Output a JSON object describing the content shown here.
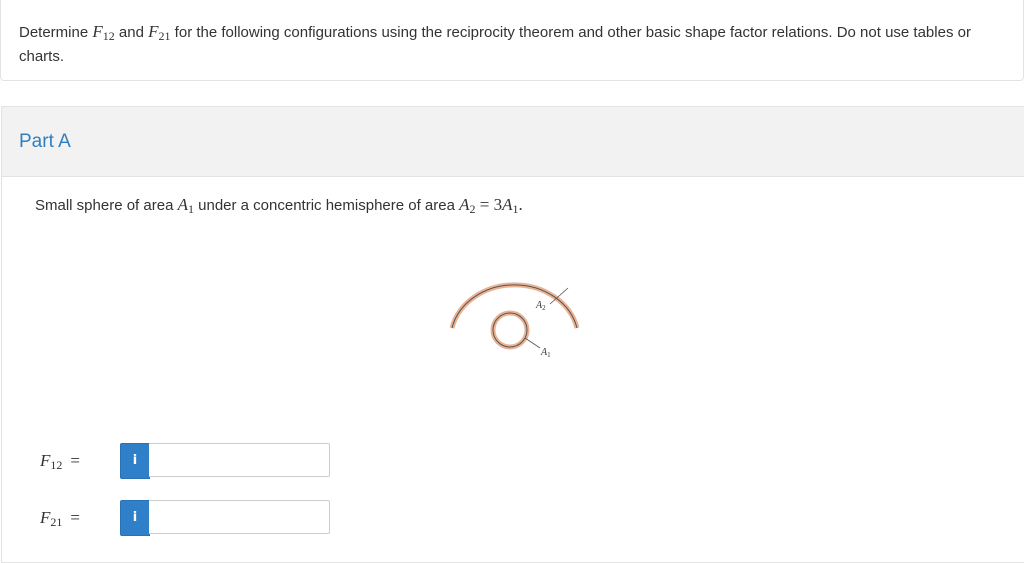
{
  "question": {
    "prefix": "Determine ",
    "f12_sym": "F",
    "f12_sub": "12",
    "and_word": " and ",
    "f21_sym": "F",
    "f21_sub": "21",
    "suffix": " for the following configurations using the reciprocity theorem and other basic shape factor relations. Do not use tables or charts."
  },
  "part": {
    "title": "Part A",
    "desc_prefix": "Small sphere of area ",
    "a1_sym": "A",
    "a1_sub": "1",
    "desc_mid": " under a concentric hemisphere of area ",
    "a2_sym": "A",
    "a2_sub": "2",
    "eq_text": " = 3",
    "a1b_sym": "A",
    "a1b_sub": "1",
    "desc_end": "."
  },
  "figure": {
    "label_a2": "A",
    "label_a2_sub": "2",
    "label_a1": "A",
    "label_a1_sub": "1",
    "shell_color": "#e9b393",
    "line_color": "#555555"
  },
  "answers": [
    {
      "sym": "F",
      "sub": "12",
      "eq": "=",
      "info": "i",
      "value": ""
    },
    {
      "sym": "F",
      "sub": "21",
      "eq": "=",
      "info": "i",
      "value": ""
    }
  ],
  "colors": {
    "accent": "#2f7fc0",
    "button": "#2f80c8",
    "header_bg": "#f2f2f2"
  }
}
